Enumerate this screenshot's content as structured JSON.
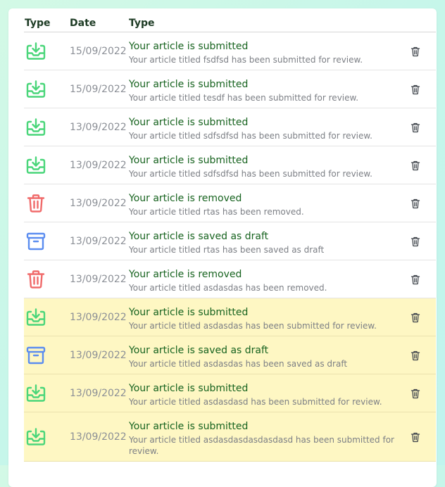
{
  "table": {
    "headers": [
      "Type",
      "Date",
      "Type"
    ],
    "rows": [
      {
        "icon": "inbox-download-icon",
        "date": "15/09/2022",
        "title": "Your article is submitted",
        "message": "Your article titled fsdfsd has been submitted for review.",
        "highlighted": false
      },
      {
        "icon": "inbox-download-icon",
        "date": "15/09/2022",
        "title": "Your article is submitted",
        "message": "Your article titled tesdf has been submitted for review.",
        "highlighted": false
      },
      {
        "icon": "inbox-download-icon",
        "date": "13/09/2022",
        "title": "Your article is submitted",
        "message": "Your article titled sdfsdfsd has been submitted for review.",
        "highlighted": false
      },
      {
        "icon": "inbox-download-icon",
        "date": "13/09/2022",
        "title": "Your article is submitted",
        "message": "Your article titled sdfsdfsd has been submitted for review.",
        "highlighted": false
      },
      {
        "icon": "trash-icon",
        "date": "13/09/2022",
        "title": "Your article is removed",
        "message": "Your article titled rtas has been removed.",
        "highlighted": false
      },
      {
        "icon": "archive-icon",
        "date": "13/09/2022",
        "title": "Your article is saved as draft",
        "message": "Your article titled rtas has been saved as draft",
        "highlighted": false
      },
      {
        "icon": "trash-icon",
        "date": "13/09/2022",
        "title": "Your article is removed",
        "message": "Your article titled asdasdas has been removed.",
        "highlighted": false
      },
      {
        "icon": "inbox-download-icon",
        "date": "13/09/2022",
        "title": "Your article is submitted",
        "message": "Your article titled asdasdas has been submitted for review.",
        "highlighted": true
      },
      {
        "icon": "archive-icon",
        "date": "13/09/2022",
        "title": "Your article is saved as draft",
        "message": "Your article titled asdasdas has been saved as draft",
        "highlighted": true
      },
      {
        "icon": "inbox-download-icon",
        "date": "13/09/2022",
        "title": "Your article is submitted",
        "message": "Your article titled asdasdasd has been submitted for review.",
        "highlighted": true
      },
      {
        "icon": "inbox-download-icon",
        "date": "13/09/2022",
        "title": "Your article is submitted",
        "message": "Your article titled asdasdasdasdasdasd has been submitted for review.",
        "highlighted": true
      }
    ]
  },
  "colors": {
    "submitted_icon": "#4ad67a",
    "removed_icon": "#f06a6a",
    "draft_icon": "#5b8df0",
    "title_text": "#17631f",
    "date_text": "#8b8f96",
    "highlight_row": "#fef7c3"
  }
}
